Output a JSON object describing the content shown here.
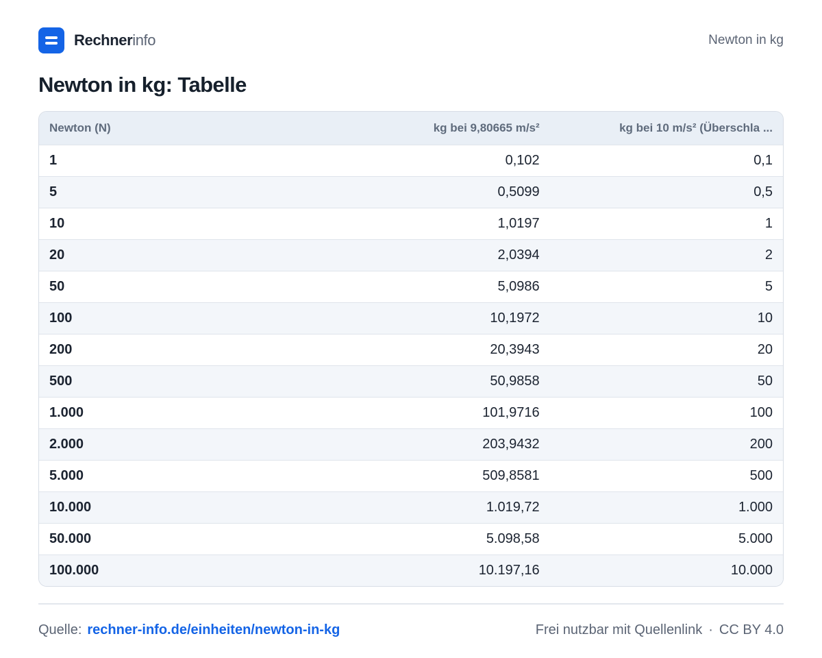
{
  "brand": {
    "name_strong": "Rechner",
    "name_light": "info"
  },
  "header": {
    "nav_link": "Newton in kg"
  },
  "page": {
    "title": "Newton in kg: Tabelle"
  },
  "table": {
    "columns": [
      "Newton (N)",
      "kg bei 9,80665 m/s²",
      "kg bei 10 m/s² (Überschla ..."
    ],
    "rows": [
      [
        "1",
        "0,102",
        "0,1"
      ],
      [
        "5",
        "0,5099",
        "0,5"
      ],
      [
        "10",
        "1,0197",
        "1"
      ],
      [
        "20",
        "2,0394",
        "2"
      ],
      [
        "50",
        "5,0986",
        "5"
      ],
      [
        "100",
        "10,1972",
        "10"
      ],
      [
        "200",
        "20,3943",
        "20"
      ],
      [
        "500",
        "50,9858",
        "50"
      ],
      [
        "1.000",
        "101,9716",
        "100"
      ],
      [
        "2.000",
        "203,9432",
        "200"
      ],
      [
        "5.000",
        "509,8581",
        "500"
      ],
      [
        "10.000",
        "1.019,72",
        "1.000"
      ],
      [
        "50.000",
        "5.098,58",
        "5.000"
      ],
      [
        "100.000",
        "10.197,16",
        "10.000"
      ]
    ]
  },
  "footer": {
    "source_label": "Quelle:",
    "source_link": "rechner-info.de/einheiten/newton-in-kg",
    "license_text": "Frei nutzbar mit Quellenlink",
    "separator": "·",
    "license": "CC BY 4.0"
  },
  "colors": {
    "accent": "#1464e6",
    "header_row_bg": "#e9eff6",
    "zebra_bg": "#f3f6fa",
    "muted_text": "#5b6474"
  }
}
